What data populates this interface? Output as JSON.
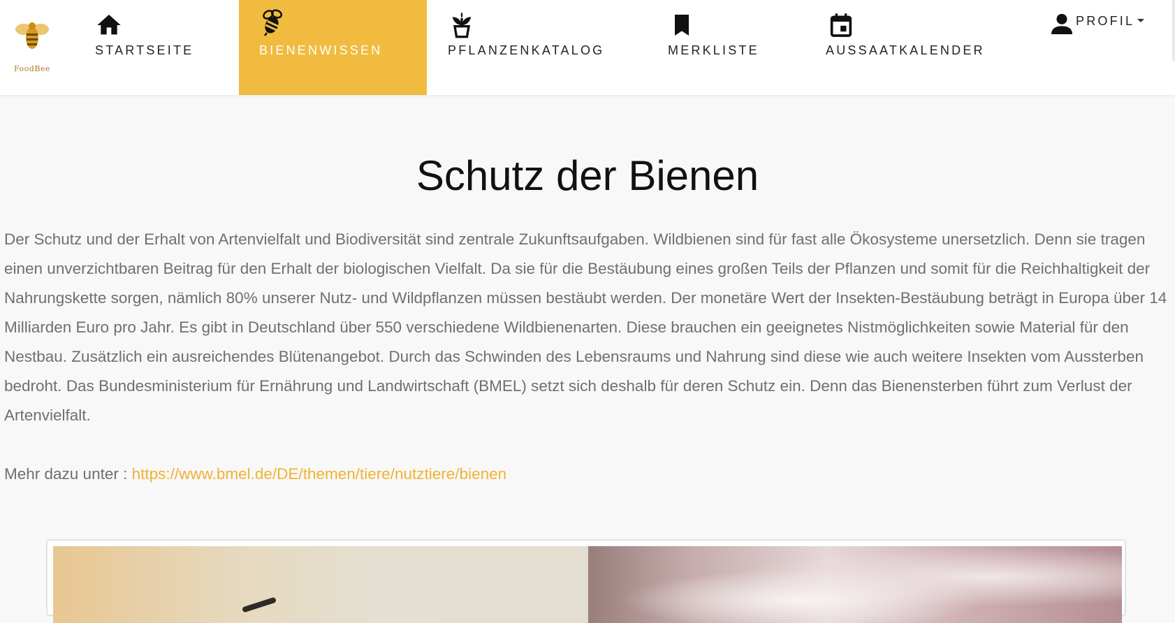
{
  "brand": {
    "logo_text": "FoodBee"
  },
  "nav": {
    "items": [
      {
        "label": "STARTSEITE",
        "icon": "home-icon"
      },
      {
        "label": "BIENENWISSEN",
        "icon": "bee-icon",
        "active": true
      },
      {
        "label": "PFLANZENKATALOG",
        "icon": "plant-icon"
      },
      {
        "label": "MERKLISTE",
        "icon": "bookmark-icon"
      },
      {
        "label": "AUSSAATKALENDER",
        "icon": "calendar-icon"
      }
    ],
    "profile_label": "PROFIL",
    "profile_icon": "user-icon"
  },
  "main": {
    "title": "Schutz der Bienen",
    "paragraph": "Der Schutz und der Erhalt von Artenvielfalt und Biodiversität sind zentrale Zukunftsaufgaben. Wildbienen sind für fast alle Ökosysteme unersetzlich. Denn sie tragen einen unverzichtbaren Beitrag für den Erhalt der biologischen Vielfalt. Da sie für die Bestäubung eines großen Teils der Pflanzen und somit für die Reichhaltigkeit der Nahrungskette sorgen, nämlich 80% unserer Nutz- und Wildpflanzen müssen bestäubt werden. Der monetäre Wert der Insekten-Bestäubung beträgt in Europa über 14 Milliarden Euro pro Jahr. Es gibt in Deutschland über 550 verschiedene Wildbienenarten. Diese brauchen ein geeignetes Nistmöglichkeiten sowie Material für den Nestbau. Zusätzlich ein ausreichendes Blütenangebot. Durch das Schwinden des Lebensraums und Nahrung sind diese wie auch weitere Insekten vom Aussterben bedroht. Das Bundesministerium für Ernährung und Landwirtschaft (BMEL) setzt sich deshalb für deren Schutz ein. Denn das Bienensterben führt zum Verlust der Artenvielfalt.",
    "more_prefix": "Mehr dazu unter : ",
    "more_link": "https://www.bmel.de/DE/themen/tiere/nutztiere/bienen"
  },
  "colors": {
    "accent": "#f0bb3f",
    "link": "#f0b233",
    "body_text": "#6f6f6f",
    "background": "#f8f8f8"
  }
}
